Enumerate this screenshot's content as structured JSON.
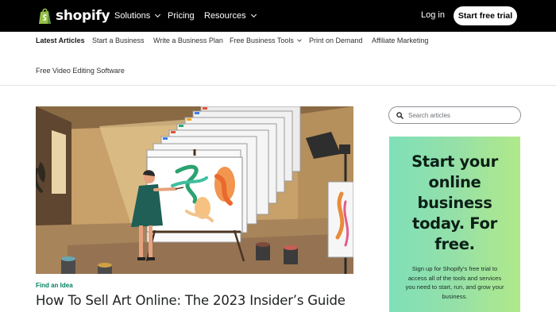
{
  "header": {
    "brand": "shopify",
    "nav": [
      {
        "label": "Solutions",
        "has_dropdown": true
      },
      {
        "label": "Pricing",
        "has_dropdown": false
      },
      {
        "label": "Resources",
        "has_dropdown": true
      }
    ],
    "login_label": "Log in",
    "cta_label": "Start free trial"
  },
  "subnav": {
    "items": [
      {
        "label": "Latest Articles",
        "active": true
      },
      {
        "label": "Start a Business"
      },
      {
        "label": "Write a Business Plan"
      },
      {
        "label": "Free Business Tools",
        "has_dropdown": true
      },
      {
        "label": "Print on Demand"
      },
      {
        "label": "Affiliate Marketing"
      },
      {
        "label": "Free Video Editing Software"
      }
    ]
  },
  "article": {
    "category": "Find an Idea",
    "title": "How To Sell Art Online: The 2023 Insider’s Guide"
  },
  "search": {
    "placeholder": "Search articles",
    "icon": "search-icon"
  },
  "promo": {
    "title_lines": [
      "Start your",
      "online",
      "business",
      "today. For",
      "free."
    ],
    "body_lines": [
      "Sign up for Shopify’s free trial to",
      "access all of the tools and services",
      "you need to start, run, and grow your",
      "business."
    ]
  },
  "colors": {
    "header_bg": "#000000",
    "accent_green": "#008060",
    "promo_gradient": [
      "#7fe0b8",
      "#b1e98a"
    ]
  }
}
